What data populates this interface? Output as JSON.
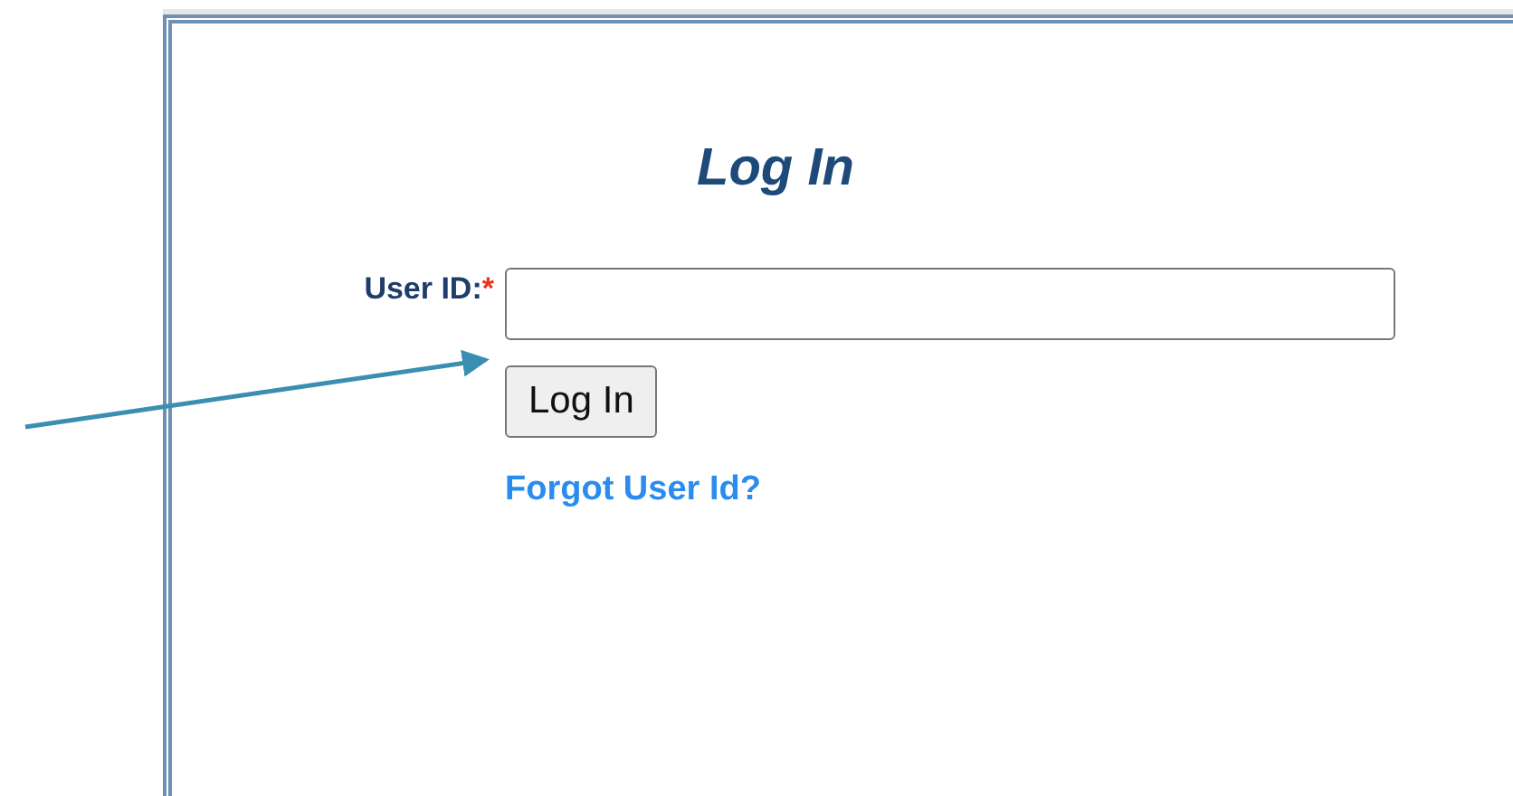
{
  "title": "Log In",
  "field": {
    "label": "User ID:",
    "required_mark": "*"
  },
  "button": "Log In",
  "link": "Forgot User Id?"
}
